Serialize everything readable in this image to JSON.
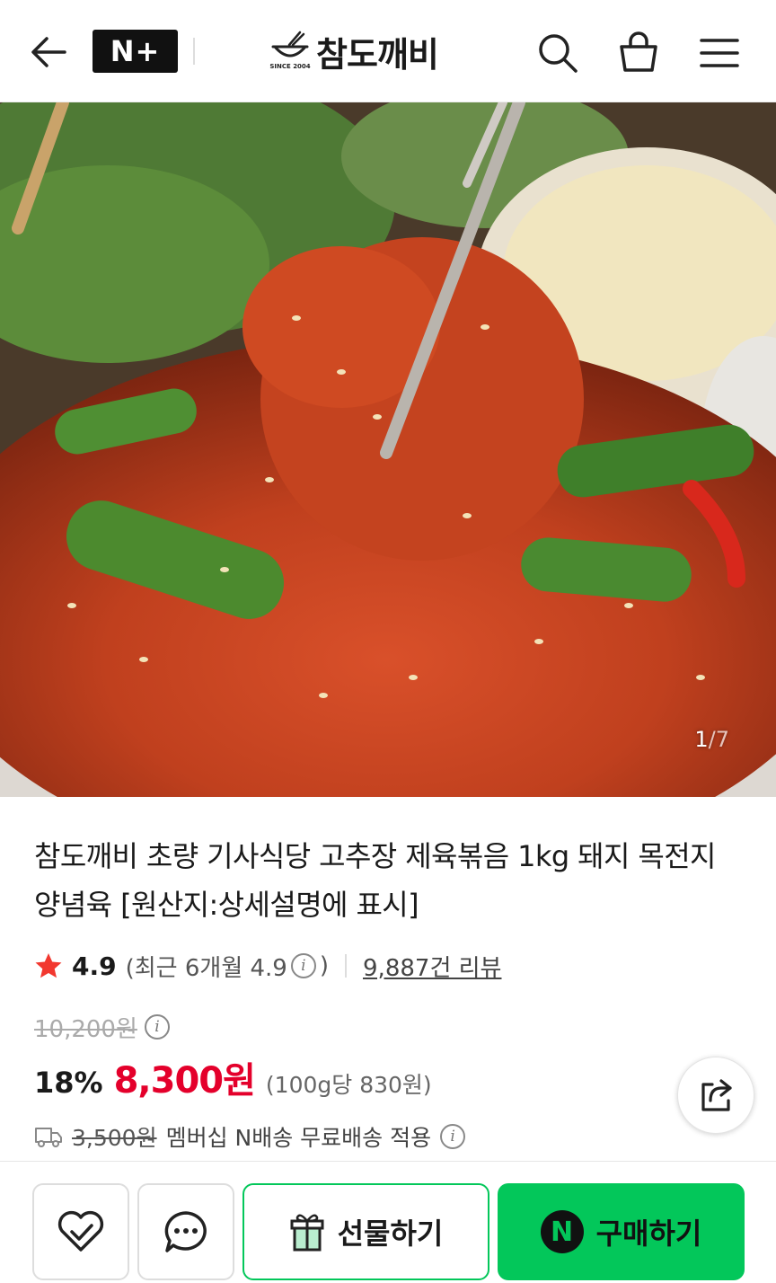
{
  "header": {
    "brand_badge": "N+",
    "brand_name": "참도깨비",
    "brand_since": "SINCE 2004"
  },
  "gallery": {
    "current": "1",
    "total": "/7"
  },
  "product": {
    "title": "참도깨비 초량 기사식당 고추장 제육볶음 1kg 돼지 목전지 양념육 [원산지:상세설명에 표시]",
    "rating": "4.9",
    "recent_rating": "(최근 6개월 4.9",
    "recent_close": ")",
    "review_count": "9,887건 리뷰",
    "original_price": "10,200원",
    "discount": "18%",
    "price": "8,300원",
    "unit_price": "(100g당 830원)",
    "shipping_fee": "3,500원",
    "shipping_note": "멤버십 N배송 무료배송 적용"
  },
  "actions": {
    "gift_label": "선물하기",
    "buy_badge": "N",
    "buy_label": "구매하기"
  },
  "colors": {
    "accent_green": "#03c75a",
    "price_red": "#e4002b",
    "star_red": "#f2382f"
  }
}
